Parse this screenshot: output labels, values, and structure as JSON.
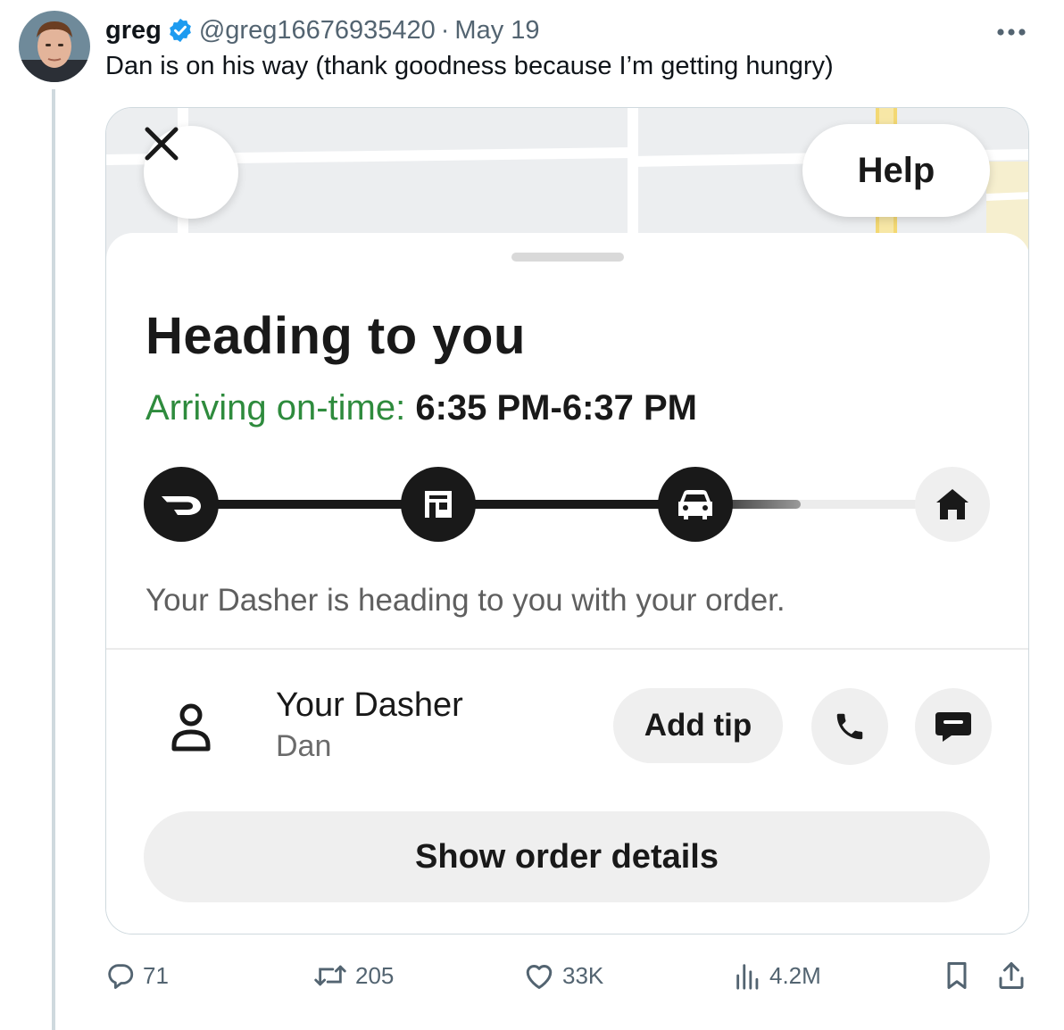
{
  "tweet": {
    "author_name": "greg",
    "handle": "@greg16676935420",
    "separator": "·",
    "date": "May 19",
    "text": "Dan is on his way (thank goodness because I’m getting hungry)"
  },
  "app": {
    "help_label": "Help",
    "title": "Heading to you",
    "eta_label": "Arriving on-time:",
    "eta_time": "6:35 PM-6:37 PM",
    "progress_fraction": 0.8,
    "steps": [
      {
        "icon": "doordash-logo-icon",
        "state": "done"
      },
      {
        "icon": "store-icon",
        "state": "done"
      },
      {
        "icon": "car-icon",
        "state": "current"
      },
      {
        "icon": "home-icon",
        "state": "pending"
      }
    ],
    "status_text": "Your Dasher is heading to you with your order.",
    "dasher_title": "Your Dasher",
    "dasher_name": "Dan",
    "add_tip_label": "Add tip",
    "order_details_label": "Show order details"
  },
  "actions": {
    "replies": "71",
    "reposts": "205",
    "likes": "33K",
    "views": "4.2M"
  },
  "colors": {
    "verified": "#1d9bf0",
    "eta_green": "#2e8b3d",
    "dark": "#191919",
    "muted": "#536471"
  }
}
